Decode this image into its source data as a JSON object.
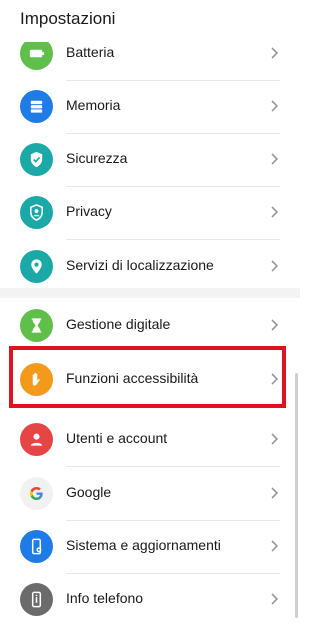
{
  "header": {
    "title": "Impostazioni"
  },
  "colors": {
    "green": "#5fbf4a",
    "blue": "#1f7be6",
    "teal": "#1aa9a6",
    "orange": "#f39a1a",
    "red": "#e64545",
    "gray": "#6b6b6b",
    "highlight": "#e0121f"
  },
  "items": [
    {
      "label": "Batteria",
      "icon": "battery-icon"
    },
    {
      "label": "Memoria",
      "icon": "storage-icon"
    },
    {
      "label": "Sicurezza",
      "icon": "shield-check-icon"
    },
    {
      "label": "Privacy",
      "icon": "privacy-shield-icon"
    },
    {
      "label": "Servizi di localizzazione",
      "icon": "location-pin-icon"
    },
    {
      "label": "Gestione digitale",
      "icon": "hourglass-icon"
    },
    {
      "label": "Funzioni accessibilità",
      "icon": "hand-icon"
    },
    {
      "label": "Utenti e account",
      "icon": "user-icon"
    },
    {
      "label": "Google",
      "icon": "google-icon"
    },
    {
      "label": "Sistema e aggiornamenti",
      "icon": "system-update-icon"
    },
    {
      "label": "Info telefono",
      "icon": "phone-info-icon"
    }
  ]
}
